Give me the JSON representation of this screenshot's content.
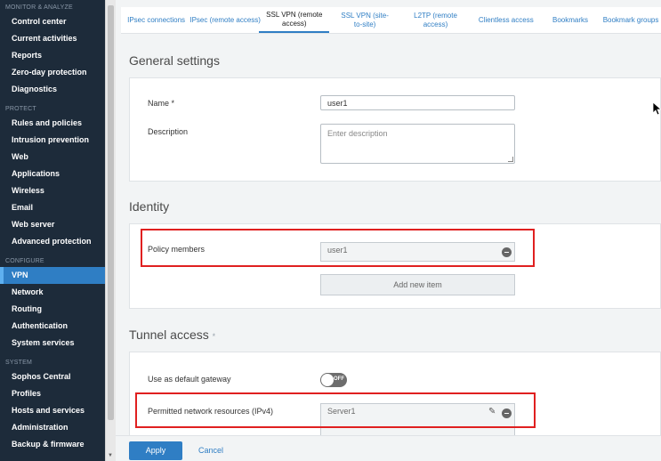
{
  "sidebar": {
    "sections": [
      {
        "label": "MONITOR & ANALYZE",
        "items": [
          "Control center",
          "Current activities",
          "Reports",
          "Zero-day protection",
          "Diagnostics"
        ]
      },
      {
        "label": "PROTECT",
        "items": [
          "Rules and policies",
          "Intrusion prevention",
          "Web",
          "Applications",
          "Wireless",
          "Email",
          "Web server",
          "Advanced protection"
        ]
      },
      {
        "label": "CONFIGURE",
        "items": [
          "VPN",
          "Network",
          "Routing",
          "Authentication",
          "System services"
        ]
      },
      {
        "label": "SYSTEM",
        "items": [
          "Sophos Central",
          "Profiles",
          "Hosts and services",
          "Administration",
          "Backup & firmware"
        ]
      }
    ],
    "active_item": "VPN"
  },
  "tabs": [
    "IPsec connections",
    "IPsec (remote access)",
    "SSL VPN (remote access)",
    "SSL VPN (site-to-site)",
    "L2TP (remote access)",
    "Clientless access",
    "Bookmarks",
    "Bookmark groups"
  ],
  "active_tab": "SSL VPN (remote access)",
  "general": {
    "title": "General settings",
    "name_label": "Name *",
    "name_value": "user1",
    "description_label": "Description",
    "description_placeholder": "Enter description"
  },
  "identity": {
    "title": "Identity",
    "policy_members_label": "Policy members",
    "policy_member": "user1",
    "add_new_item": "Add new item"
  },
  "tunnel": {
    "title": "Tunnel access",
    "required_mark": "*",
    "default_gateway_label": "Use as default gateway",
    "toggle_state": "OFF",
    "permitted_label": "Permitted network resources (IPv4)",
    "permitted_value": "Server1"
  },
  "footer": {
    "apply": "Apply",
    "cancel": "Cancel"
  },
  "colors": {
    "sidebar_bg": "#1d2b3a",
    "accent": "#2f7ec4",
    "highlight": "#e02020"
  }
}
